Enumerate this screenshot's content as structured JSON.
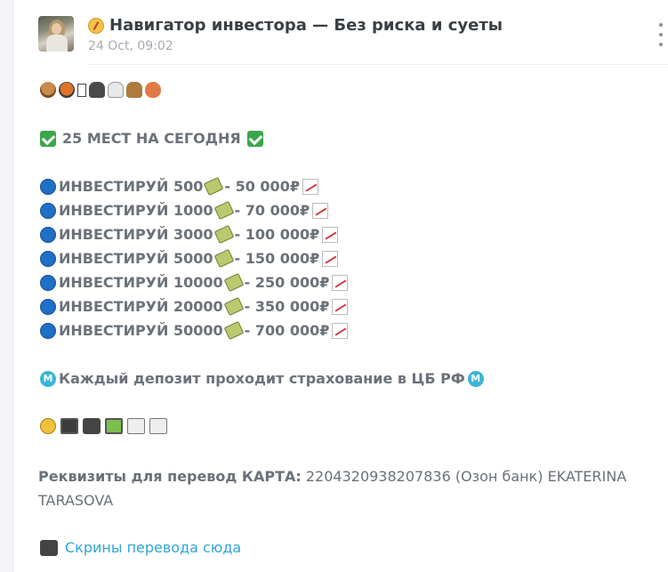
{
  "post": {
    "channel_title": "Навигатор инвестора — Без риска и суеты",
    "date": "24 Oct, 09:02",
    "title_icon": "compass-icon",
    "avatar_icon": "avatar-photo",
    "emoji_row": [
      "dog-icon",
      "bird-icon",
      "unknown-glyph-icon",
      "cow-icon",
      "goat-icon",
      "llama-icon",
      "chick-icon"
    ],
    "seats_line": "25 МЕСТ НА СЕГОДНЯ",
    "invest_lines": [
      {
        "amount": "ИНВЕСТИРУЙ 500",
        "result": " - 50 000₽"
      },
      {
        "amount": "ИНВЕСТИРУЙ 1000",
        "result": " - 70 000₽"
      },
      {
        "amount": "ИНВЕСТИРУЙ 3000",
        "result": " - 100 000₽"
      },
      {
        "amount": "ИНВЕСТИРУЙ 5000",
        "result": " - 150 000₽"
      },
      {
        "amount": "ИНВЕСТИРУЙ 10000",
        "result": " - 250 000₽"
      },
      {
        "amount": "ИНВЕСТИРУЙ 20000",
        "result": " - 350 000₽"
      },
      {
        "amount": "ИНВЕСТИРУЙ 50000",
        "result": " - 700 000₽"
      }
    ],
    "insurance_line": " Каждый депозит проходит страхование в ЦБ РФ",
    "objects_row": [
      "coin-icon",
      "cash-icon",
      "camera-icon",
      "pager-icon",
      "fax-icon",
      "fax-icon"
    ],
    "requisites_label": "Реквизиты для перевод КАРТА:",
    "requisites_value": " 2204320938207836 (Озон банк) EKATERINA TARASOVA",
    "screens_link": "Скрины перевода сюда",
    "accent_link_color": "#2ea6d4"
  }
}
